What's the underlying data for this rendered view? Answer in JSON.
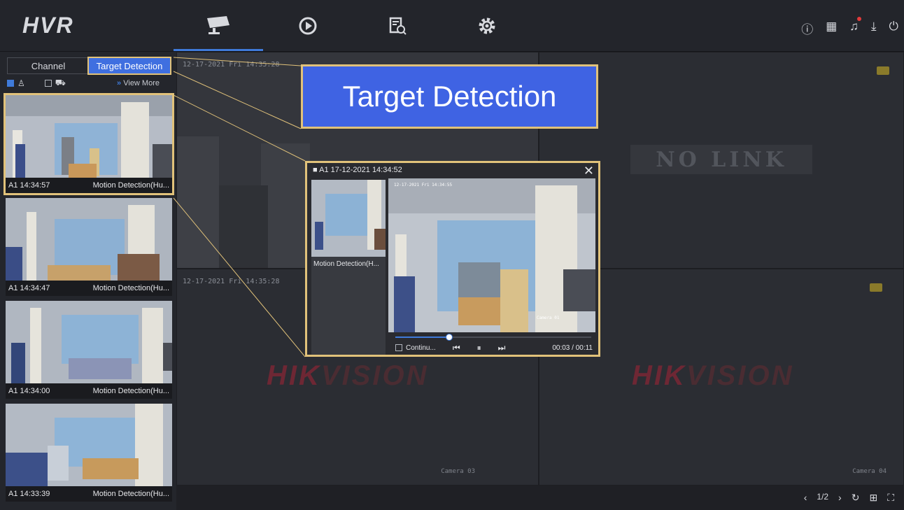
{
  "header": {
    "logo": "HVR",
    "nav_tabs": [
      {
        "icon": "camera-icon",
        "active": true
      },
      {
        "icon": "playback-icon",
        "active": false
      },
      {
        "icon": "file-search-icon",
        "active": false
      },
      {
        "icon": "gear-icon",
        "active": false
      }
    ],
    "system_icons": [
      "info-icon",
      "qr-code-icon",
      "bell-icon",
      "download-icon",
      "power-icon"
    ]
  },
  "sidebar": {
    "tabs": [
      {
        "label": "Channel"
      },
      {
        "label": "Target Detection",
        "active": true
      }
    ],
    "filters": {
      "human_checked": true,
      "vehicle_checked": false,
      "view_more": "View More"
    },
    "events": [
      {
        "time": "A1 14:34:57",
        "type": "Motion Detection(Hu..."
      },
      {
        "time": "A1 14:34:47",
        "type": "Motion Detection(Hu..."
      },
      {
        "time": "A1 14:34:00",
        "type": "Motion Detection(Hu..."
      },
      {
        "time": "A1 14:33:39",
        "type": "Motion Detection(Hu..."
      }
    ]
  },
  "grid": {
    "cells": [
      {
        "timestamp": "12-17-2021 Fri 14:35:28"
      },
      {
        "status": "NO LINK"
      },
      {
        "timestamp": "12-17-2021 Fri 14:35:28",
        "watermark": "HIKVISION",
        "camera": "Camera 03"
      },
      {
        "watermark": "HIKVISION",
        "camera": "Camera 04"
      }
    ]
  },
  "callout": {
    "label": "Target Detection"
  },
  "popup": {
    "title": "A1 17-12-2021 14:34:52",
    "thumb_label": "Motion Detection(H...",
    "video_timestamp": "12-17-2021 Fri 14:34:55",
    "camera_label": "Camera 01",
    "continue_label": "Continu...",
    "time": "00:03 / 00:11",
    "progress": 0.27
  },
  "footer": {
    "page": "1/2"
  },
  "colors": {
    "accent": "#3f7ad9",
    "highlight": "#e1c27a",
    "callout_bg": "#3f63e3"
  }
}
